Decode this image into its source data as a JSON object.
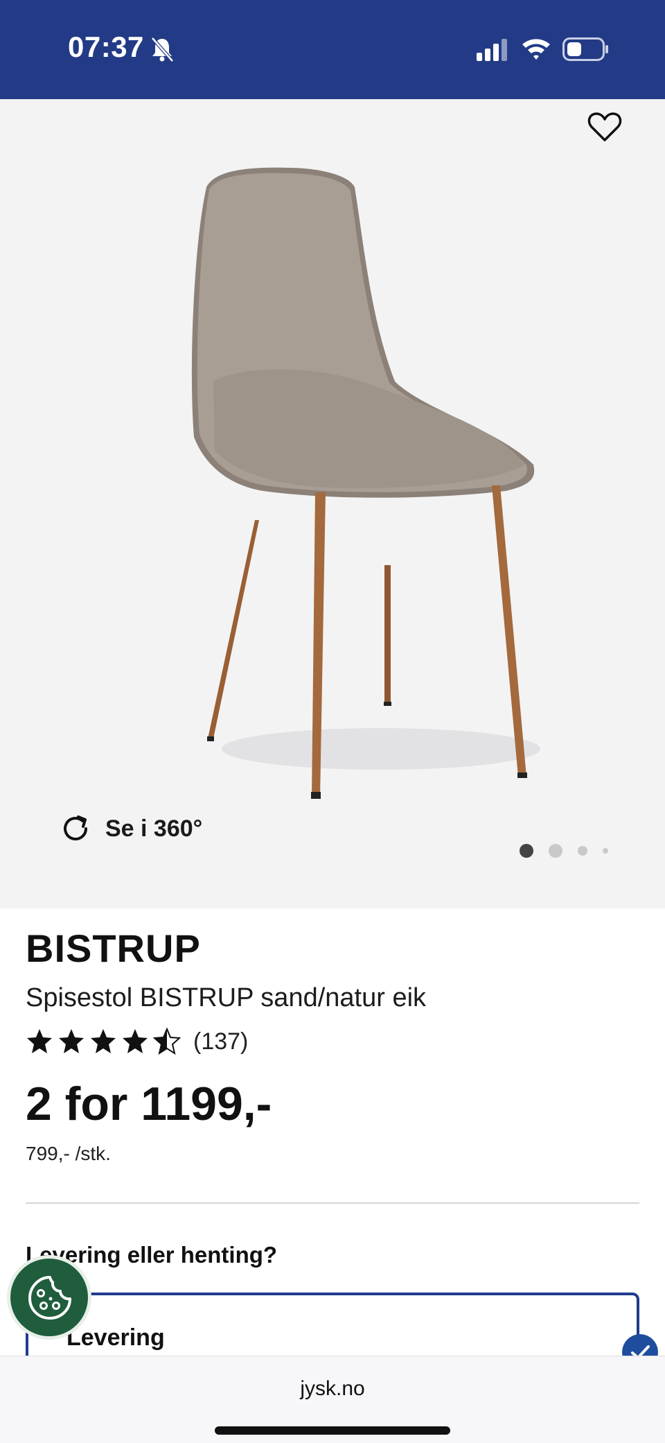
{
  "status_bar": {
    "time": "07:37",
    "bell_icon": "bell-slash-icon",
    "signal_icon": "cellular-signal-icon",
    "wifi_icon": "wifi-icon",
    "battery_icon": "battery-icon"
  },
  "gallery": {
    "favorite_icon": "heart-icon",
    "view360_label": "Se i 360°",
    "dots_count": 4,
    "active_dot": 1
  },
  "product": {
    "name": "BISTRUP",
    "description": "Spisestol BISTRUP sand/natur eik",
    "rating_value": 4.5,
    "rating_count": "(137)",
    "price_main": "2 for 1199,-",
    "price_unit": "799,- /stk."
  },
  "delivery": {
    "heading": "Levering eller henting?",
    "option_label": "Levering"
  },
  "browser": {
    "url": "jysk.no"
  },
  "colors": {
    "brand_blue": "#233a86",
    "cookie_green": "#1f5d3d"
  }
}
